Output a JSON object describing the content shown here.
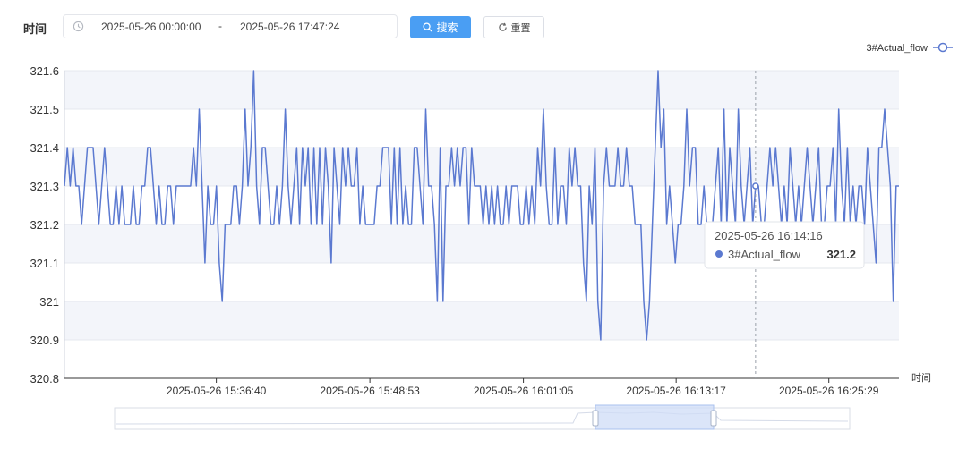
{
  "filter": {
    "label": "时间",
    "start": "2025-05-26 00:00:00",
    "separator": "-",
    "end": "2025-05-26 17:47:24",
    "search_label": "搜索",
    "reset_label": "重置"
  },
  "colors": {
    "series": "#5b79d0",
    "accent": "#4a9ef3",
    "band": "#f3f5fa",
    "grid": "#e6e8ef"
  },
  "chart_data": {
    "type": "line",
    "title": "",
    "xlabel": "时间",
    "ylabel": "",
    "ylim": [
      320.8,
      321.6
    ],
    "yticks": [
      "321.6",
      "321.5",
      "321.4",
      "321.3",
      "321.2",
      "321.1",
      "321",
      "320.9",
      "320.8"
    ],
    "xticks": [
      "2025-05-26 15:36:40",
      "2025-05-26 15:48:53",
      "2025-05-26 16:01:05",
      "2025-05-26 16:13:17",
      "2025-05-26 16:25:29"
    ],
    "legend": "top-right",
    "grid": true,
    "series": [
      {
        "name": "3#Actual_flow",
        "values": [
          321.3,
          321.4,
          321.3,
          321.4,
          321.3,
          321.3,
          321.2,
          321.3,
          321.4,
          321.4,
          321.4,
          321.3,
          321.2,
          321.3,
          321.4,
          321.3,
          321.2,
          321.2,
          321.3,
          321.2,
          321.3,
          321.2,
          321.2,
          321.2,
          321.3,
          321.2,
          321.2,
          321.3,
          321.3,
          321.4,
          321.4,
          321.3,
          321.2,
          321.3,
          321.2,
          321.2,
          321.3,
          321.3,
          321.2,
          321.3,
          321.3,
          321.3,
          321.3,
          321.3,
          321.3,
          321.4,
          321.3,
          321.5,
          321.3,
          321.1,
          321.3,
          321.2,
          321.2,
          321.3,
          321.1,
          321.0,
          321.2,
          321.2,
          321.2,
          321.3,
          321.3,
          321.2,
          321.3,
          321.5,
          321.3,
          321.4,
          321.6,
          321.3,
          321.2,
          321.4,
          321.4,
          321.3,
          321.2,
          321.2,
          321.3,
          321.2,
          321.3,
          321.5,
          321.3,
          321.2,
          321.3,
          321.4,
          321.2,
          321.4,
          321.3,
          321.4,
          321.2,
          321.4,
          321.2,
          321.4,
          321.2,
          321.4,
          321.3,
          321.1,
          321.4,
          321.3,
          321.2,
          321.4,
          321.3,
          321.4,
          321.3,
          321.3,
          321.4,
          321.2,
          321.3,
          321.2,
          321.2,
          321.2,
          321.2,
          321.3,
          321.3,
          321.4,
          321.4,
          321.4,
          321.2,
          321.4,
          321.2,
          321.4,
          321.2,
          321.3,
          321.2,
          321.2,
          321.4,
          321.4,
          321.3,
          321.2,
          321.5,
          321.3,
          321.3,
          321.2,
          321.0,
          321.4,
          321.0,
          321.3,
          321.3,
          321.4,
          321.3,
          321.4,
          321.3,
          321.4,
          321.4,
          321.2,
          321.4,
          321.3,
          321.3,
          321.3,
          321.2,
          321.3,
          321.2,
          321.3,
          321.2,
          321.3,
          321.2,
          321.2,
          321.3,
          321.2,
          321.3,
          321.3,
          321.3,
          321.2,
          321.2,
          321.3,
          321.2,
          321.3,
          321.2,
          321.4,
          321.3,
          321.5,
          321.3,
          321.2,
          321.2,
          321.4,
          321.2,
          321.3,
          321.3,
          321.2,
          321.4,
          321.3,
          321.4,
          321.3,
          321.3,
          321.1,
          321.0,
          321.3,
          321.2,
          321.4,
          321.0,
          320.9,
          321.3,
          321.4,
          321.3,
          321.3,
          321.3,
          321.4,
          321.3,
          321.3,
          321.4,
          321.3,
          321.3,
          321.2,
          321.2,
          321.2,
          321.0,
          320.9,
          321.0,
          321.2,
          321.4,
          321.6,
          321.4,
          321.5,
          321.2,
          321.3,
          321.2,
          321.1,
          321.2,
          321.2,
          321.3,
          321.5,
          321.3,
          321.4,
          321.4,
          321.2,
          321.2,
          321.3,
          321.2,
          321.1,
          321.2,
          321.3,
          321.4,
          321.2,
          321.5,
          321.2,
          321.4,
          321.3,
          321.2,
          321.5,
          321.3,
          321.2,
          321.3,
          321.4,
          321.2,
          321.3,
          321.3,
          321.2,
          321.2,
          321.3,
          321.4,
          321.3,
          321.4,
          321.3,
          321.2,
          321.3,
          321.2,
          321.4,
          321.3,
          321.2,
          321.3,
          321.2,
          321.3,
          321.4,
          321.3,
          321.2,
          321.3,
          321.4,
          321.2,
          321.2,
          321.3,
          321.3,
          321.4,
          321.2,
          321.5,
          321.3,
          321.2,
          321.4,
          321.2,
          321.3,
          321.2,
          321.3,
          321.3,
          321.2,
          321.4,
          321.3,
          321.2,
          321.1,
          321.4,
          321.4,
          321.5,
          321.4,
          321.3,
          321.0,
          321.3,
          321.3
        ],
        "tooltip": {
          "time": "2025-05-26 16:14:16",
          "name": "3#Actual_flow",
          "value": "321.2"
        }
      }
    ]
  }
}
